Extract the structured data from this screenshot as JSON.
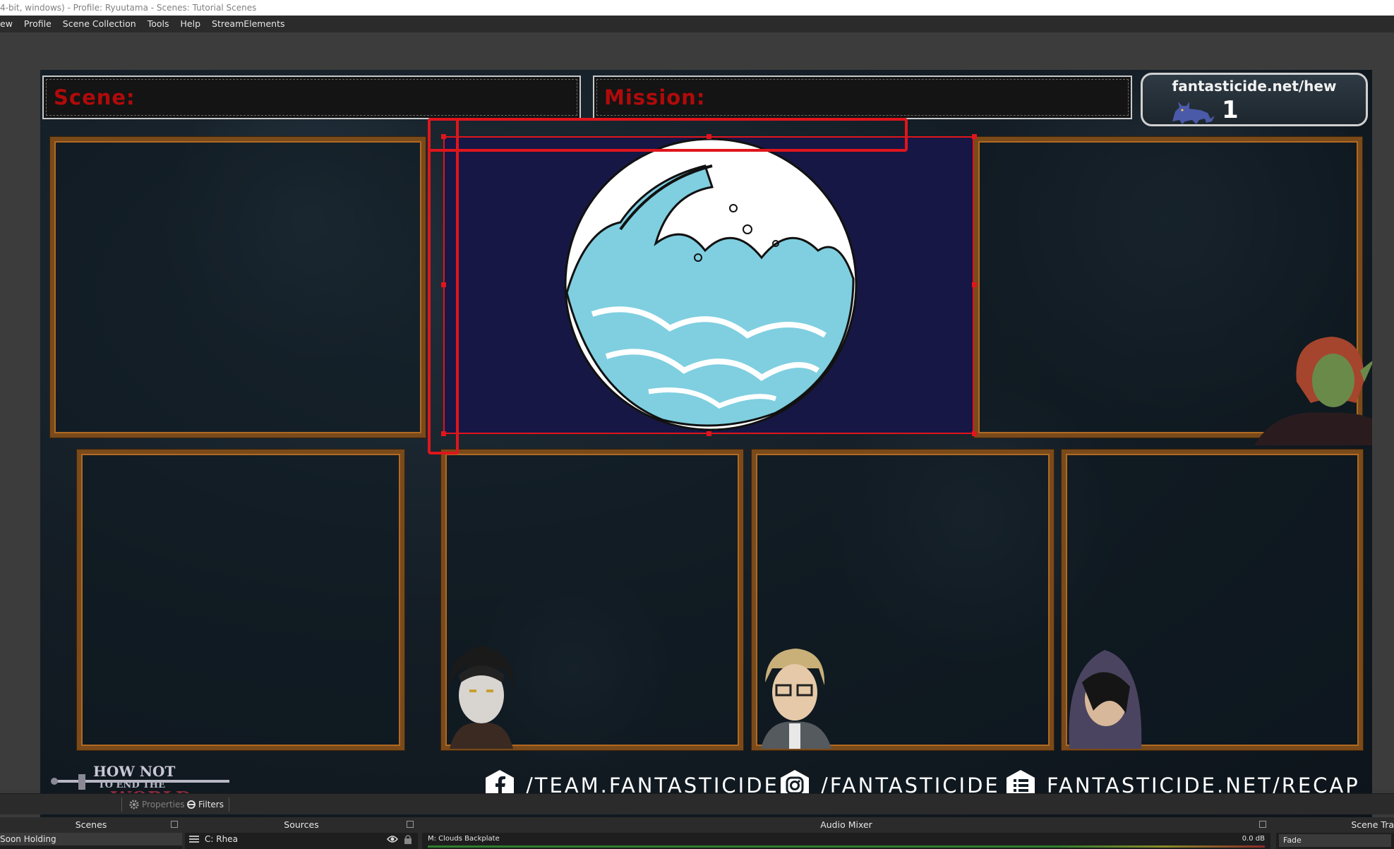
{
  "window": {
    "title": "4-bit, windows) - Profile: Ryuutama - Scenes: Tutorial Scenes"
  },
  "menu": [
    "ew",
    "Profile",
    "Scene Collection",
    "Tools",
    "Help",
    "StreamElements"
  ],
  "overlay": {
    "scene_label": "Scene:",
    "mission_label": "Mission:",
    "counter_url": "fantasticide.net/hew",
    "counter_value": "1",
    "logo_line1": "HOW NOT",
    "logo_line2": "TO END THE",
    "logo_line3": "WORLD",
    "socials": [
      {
        "icon": "facebook-icon",
        "text": "/TEAM.FANTASTICIDE"
      },
      {
        "icon": "instagram-icon",
        "text": "/FANTASTICIDE"
      },
      {
        "icon": "list-icon",
        "text": "FANTASTICIDE.NET/RECAP"
      }
    ]
  },
  "colors": {
    "selection": "#e0151c",
    "frame": "#7a4a1a",
    "header_text": "#b00a0a",
    "world_bg": "#171745"
  },
  "toolbar": {
    "properties_label": "Properties",
    "filters_label": "Filters"
  },
  "docks": {
    "scenes": {
      "title": "Scenes",
      "items": [
        "Soon Holding"
      ]
    },
    "sources": {
      "title": "Sources",
      "items": [
        "C: Rhea"
      ]
    },
    "mixer": {
      "title": "Audio Mixer",
      "channel": "M: Clouds Backplate",
      "level": "0.0 dB"
    },
    "transitions": {
      "title": "Scene Tra",
      "value": "Fade"
    }
  }
}
